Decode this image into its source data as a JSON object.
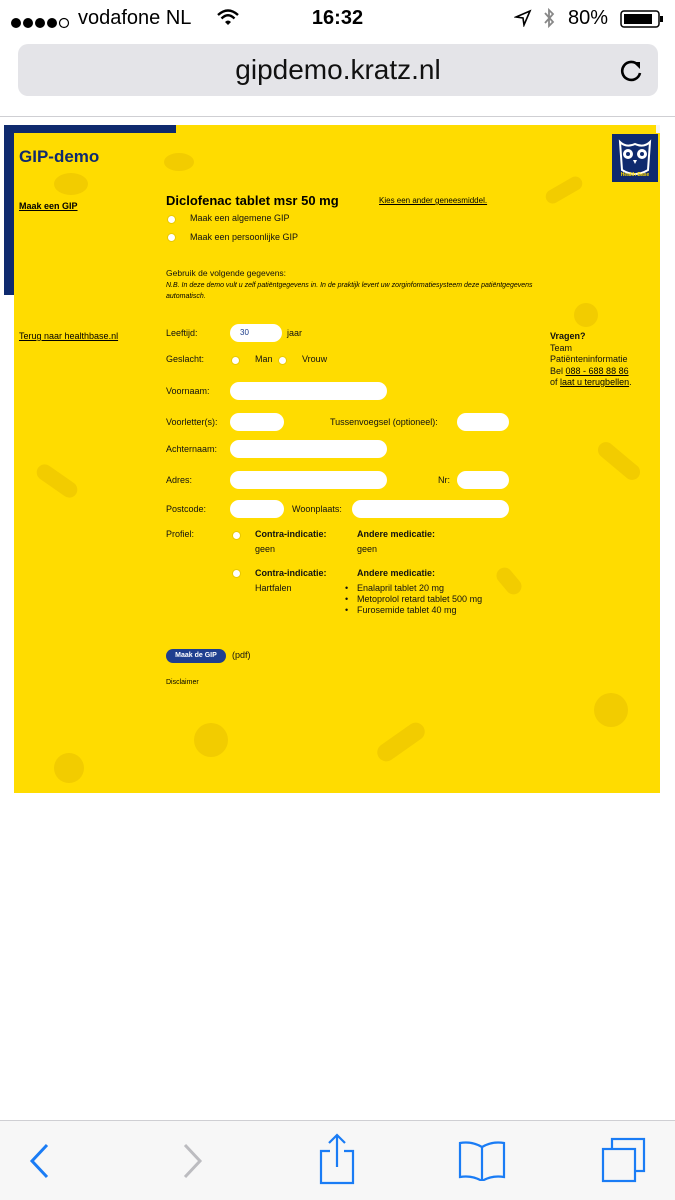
{
  "status": {
    "carrier": "vodafone NL",
    "time": "16:32",
    "battery": "80%"
  },
  "browser": {
    "url": "gipdemo.kratz.nl"
  },
  "site": {
    "title": "GIP-demo",
    "nav": {
      "make_gip": "Maak een GIP",
      "back": "Terug naar healthbase.nl"
    },
    "drug": {
      "name": "Diclofenac tablet msr 50 mg",
      "change_link": "Kies een ander geneesmiddel."
    },
    "gip_options": {
      "general": "Maak een algemene GIP",
      "personal": "Maak een persoonlijke GIP"
    },
    "intro": {
      "heading": "Gebruik de volgende gegevens:",
      "note": "N.B. In deze demo vult u zelf patiëntgegevens in. In de praktijk levert uw zorginformatiesysteem deze patiëntgegevens automatisch."
    },
    "form": {
      "age_label": "Leeftijd:",
      "age_value": "30",
      "age_unit": "jaar",
      "gender_label": "Geslacht:",
      "gender_m": "Man",
      "gender_f": "Vrouw",
      "firstname_label": "Voornaam:",
      "initials_label": "Voorletter(s):",
      "prefix_label": "Tussenvoegsel (optioneel):",
      "lastname_label": "Achternaam:",
      "address_label": "Adres:",
      "number_label": "Nr:",
      "postcode_label": "Postcode:",
      "city_label": "Woonplaats:",
      "profile_label": "Profiel:"
    },
    "profiles": [
      {
        "contra_heading": "Contra-indicatie:",
        "contra_value": "geen",
        "med_heading": "Andere medicatie:",
        "meds": [
          "geen"
        ]
      },
      {
        "contra_heading": "Contra-indicatie:",
        "contra_value": "Hartfalen",
        "med_heading": "Andere medicatie:",
        "meds": [
          "Enalapril tablet 20 mg",
          "Metoprolol retard tablet 500 mg",
          "Furosemide tablet 40 mg"
        ]
      }
    ],
    "submit": {
      "label": "Maak de GIP",
      "suffix": "(pdf)"
    },
    "disclaimer": "Disclaimer",
    "logo_text": "Health Base",
    "contact": {
      "heading": "Vragen?",
      "line1": "Team",
      "line2": "Patiënteninformatie",
      "bel": "Bel",
      "phone": "088 - 688 88 86",
      "of": "of",
      "callback": "laat u terugbellen",
      "dot": "."
    }
  },
  "colors": {
    "page_bg": "#ffdc00",
    "navy": "#0f2a6e",
    "button": "#1f3f8f"
  },
  "icons": [
    "signal-icon",
    "wifi-icon",
    "location-icon",
    "bluetooth-icon",
    "battery-icon",
    "reload-icon",
    "back-icon",
    "forward-icon",
    "share-icon",
    "bookmarks-icon",
    "tabs-icon"
  ]
}
